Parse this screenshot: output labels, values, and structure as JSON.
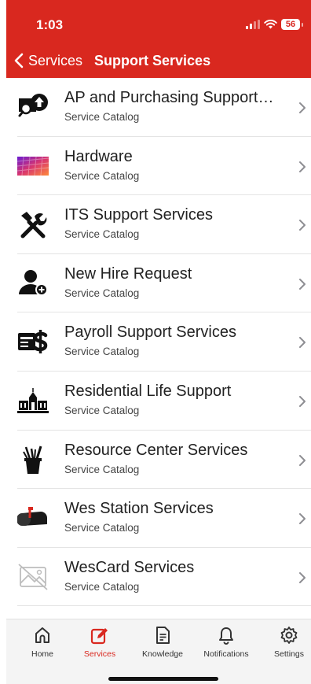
{
  "status": {
    "time": "1:03",
    "battery": "56"
  },
  "nav": {
    "back_label": "Services",
    "title": "Support Services"
  },
  "items": [
    {
      "title": "AP and Purchasing Support…",
      "subtitle": "Service Catalog",
      "icon": "purchasing-support-icon"
    },
    {
      "title": "Hardware",
      "subtitle": "Service Catalog",
      "icon": "hardware-keyboard-icon"
    },
    {
      "title": "ITS Support Services",
      "subtitle": "Service Catalog",
      "icon": "tools-icon"
    },
    {
      "title": "New Hire Request",
      "subtitle": "Service Catalog",
      "icon": "add-person-icon"
    },
    {
      "title": "Payroll Support Services",
      "subtitle": "Service Catalog",
      "icon": "payroll-dollar-icon"
    },
    {
      "title": "Residential Life Support",
      "subtitle": "Service Catalog",
      "icon": "residence-building-icon"
    },
    {
      "title": "Resource Center Services",
      "subtitle": "Service Catalog",
      "icon": "supplies-cup-icon"
    },
    {
      "title": "Wes Station Services",
      "subtitle": "Service Catalog",
      "icon": "mailbox-icon"
    },
    {
      "title": "WesCard Services",
      "subtitle": "Service Catalog",
      "icon": "image-placeholder-icon"
    }
  ],
  "tabs": [
    {
      "label": "Home",
      "icon": "home-icon",
      "active": false
    },
    {
      "label": "Services",
      "icon": "services-edit-icon",
      "active": true
    },
    {
      "label": "Knowledge",
      "icon": "document-icon",
      "active": false
    },
    {
      "label": "Notifications",
      "icon": "bell-icon",
      "active": false
    },
    {
      "label": "Settings",
      "icon": "gear-icon",
      "active": false
    }
  ],
  "colors": {
    "brand": "#d9281f",
    "text": "#222222",
    "chevron": "#8e8e93"
  }
}
